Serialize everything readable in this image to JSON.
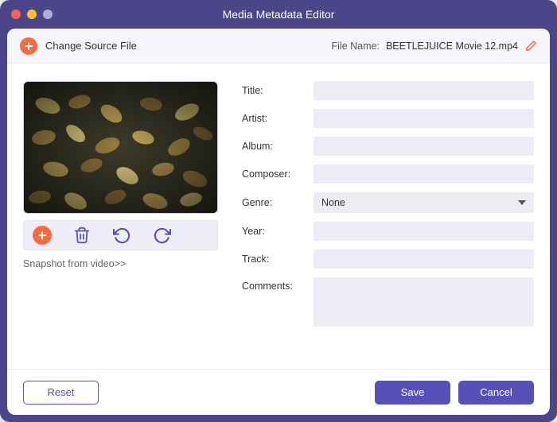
{
  "window": {
    "title": "Media Metadata Editor"
  },
  "toolbar": {
    "change_source_label": "Change Source File",
    "filename_label": "File Name:",
    "filename_value": "BEETLEJUICE Movie 12.mp4"
  },
  "thumb_toolbar": {
    "add_icon": "plus",
    "delete_icon": "trash",
    "rotate_left_icon": "rotate-ccw",
    "rotate_right_icon": "rotate-cw"
  },
  "snapshot_link": "Snapshot from video>>",
  "fields": {
    "title": {
      "label": "Title:",
      "value": ""
    },
    "artist": {
      "label": "Artist:",
      "value": ""
    },
    "album": {
      "label": "Album:",
      "value": ""
    },
    "composer": {
      "label": "Composer:",
      "value": ""
    },
    "genre": {
      "label": "Genre:",
      "value": "None"
    },
    "year": {
      "label": "Year:",
      "value": ""
    },
    "track": {
      "label": "Track:",
      "value": ""
    },
    "comments": {
      "label": "Comments:",
      "value": ""
    }
  },
  "buttons": {
    "reset": "Reset",
    "save": "Save",
    "cancel": "Cancel"
  },
  "colors": {
    "brand": "#4b4689",
    "accent": "#ff6a3d",
    "primary_btn": "#5650b9",
    "input_bg": "#edecf4"
  }
}
